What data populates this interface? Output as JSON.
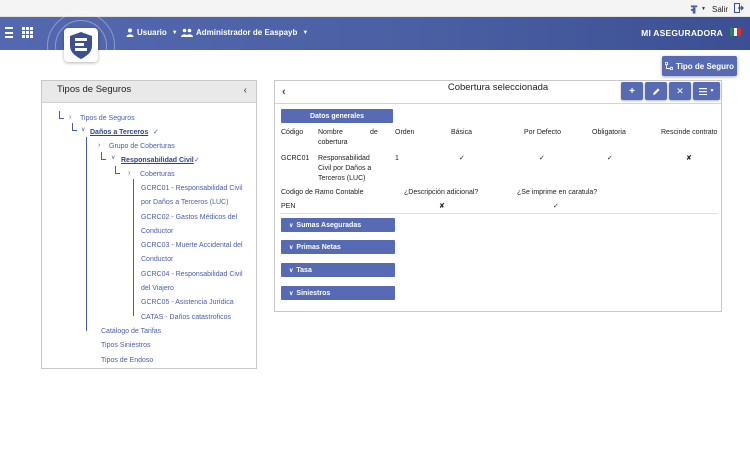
{
  "topbar": {
    "salir_label": "Salir",
    "icons": [
      "phone-icon",
      "logout-icon"
    ]
  },
  "header": {
    "usuario_label": "Usuario",
    "admin_label": "Administrador de Easpayb",
    "brand": "MI ASEGURADORA",
    "colors": {
      "header": "#4b5fa4",
      "accent": "#566bb3",
      "link": "#4a5ea8"
    }
  },
  "tipo_button": {
    "label": "Tipo de Seguro"
  },
  "left_panel": {
    "title": "Tipos de Seguros",
    "tree": {
      "root": "Tipos de Seguros",
      "danos": "Daños a Terceros",
      "grupo": "Grupo de Coberturas",
      "rc": "Responsabilidad Civil",
      "coberturas": "Coberturas",
      "gcrc01_a": "GCRC01 - Responsabilidad Civil",
      "gcrc01_b": "por Daños a Terceros (LUC)",
      "gcrc02_a": "GCRC02 - Gastos Médicos del",
      "gcrc02_b": "Conductor",
      "gcrc03_a": "GCRC03 - Muerte Accidental del",
      "gcrc03_b": "Conductor",
      "gcrc04_a": "GCRC04 - Responsabilidad Civil",
      "gcrc04_b": "del Viajero",
      "gcrc05": "GCRC05 - Asistencia Jurídica",
      "catas": "CATAS - Daños catastroficos",
      "catalogo": "Catálogo de Tarifas",
      "siniestros": "Tipos Siniestros",
      "endoso": "Tipos de Endoso"
    }
  },
  "right_panel": {
    "title": "Cobertura seleccionada",
    "datos_label": "Datos generales",
    "headers": {
      "codigo": "Código",
      "nombre_a": "Nombre",
      "nombre_de": "de",
      "nombre_b": "cobertura",
      "orden": "Orden",
      "basica": "Básica",
      "defecto": "Por Defecto",
      "obligatoria": "Obligatoria",
      "rescinde": "Rescinde contrato"
    },
    "row": {
      "codigo": "GCRC01",
      "nombre_1": "Responsabilidad",
      "nombre_2": "Civil por Daños a",
      "nombre_3": "Terceros (LUC)",
      "orden": "1",
      "basica": "✓",
      "defecto": "✓",
      "obligatoria": "✓",
      "rescinde": "✘"
    },
    "row2": {
      "ramo_label": "Codigo de Ramo Contable",
      "descripcion_label": "¿Descripción adicional?",
      "imprime_label": "¿Se imprime en caratula?",
      "ramo_value": "PEN",
      "descripcion_value": "✘",
      "imprime_value": "✓"
    },
    "sections": [
      "Sumas Aseguradas",
      "Primas Netas",
      "Tasa",
      "Siniestros"
    ]
  }
}
